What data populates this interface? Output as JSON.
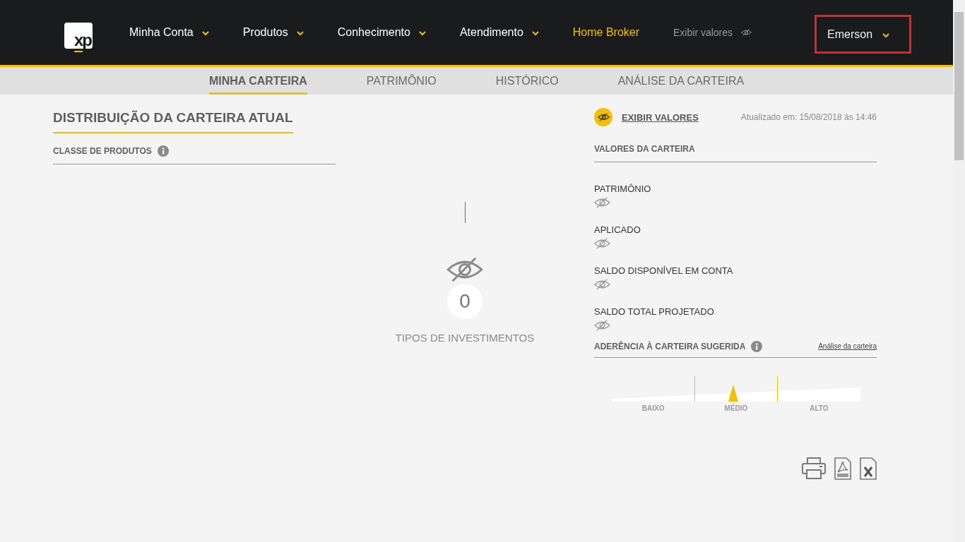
{
  "logo": {
    "text": "xp"
  },
  "nav": {
    "items": [
      {
        "label": "Minha Conta",
        "kind": "dropdown"
      },
      {
        "label": "Produtos",
        "kind": "dropdown"
      },
      {
        "label": "Conhecimento",
        "kind": "dropdown"
      },
      {
        "label": "Atendimento",
        "kind": "dropdown"
      },
      {
        "label": "Home Broker",
        "kind": "highlight"
      },
      {
        "label": "Exibir valores",
        "kind": "toggle"
      }
    ],
    "user": {
      "name": "Emerson",
      "highlighted": true
    }
  },
  "subtabs": [
    {
      "label": "MINHA CARTEIRA",
      "selected": true
    },
    {
      "label": "PATRIMÔNIO",
      "selected": false
    },
    {
      "label": "HISTÓRICO",
      "selected": false
    },
    {
      "label": "ANÁLISE DA CARTEIRA",
      "selected": false
    }
  ],
  "distribution": {
    "title": "DISTRIBUIÇÃO DA CARTEIRA ATUAL",
    "subtitle": "CLASSE DE PRODUTOS",
    "count": "0",
    "count_label": "TIPOS DE INVESTIMENTOS"
  },
  "values": {
    "toggle_label": "EXIBIR VALORES",
    "updated": "Atualizado em: 15/08/2018 às 14:46",
    "title": "VALORES DA CARTEIRA",
    "items": [
      {
        "label": "PATRIMÔNIO",
        "hidden": true
      },
      {
        "label": "APLICADO",
        "hidden": true
      },
      {
        "label": "SALDO DISPONÍVEL EM CONTA",
        "hidden": true
      },
      {
        "label": "SALDO TOTAL PROJETADO",
        "hidden": true
      }
    ]
  },
  "adherence": {
    "title": "ADERÊNCIA À CARTEIRA SUGERIDA",
    "link": "Análise da carteira",
    "level": 0.49,
    "labels": [
      "BAIXO",
      "MÉDIO",
      "ALTO"
    ]
  }
}
